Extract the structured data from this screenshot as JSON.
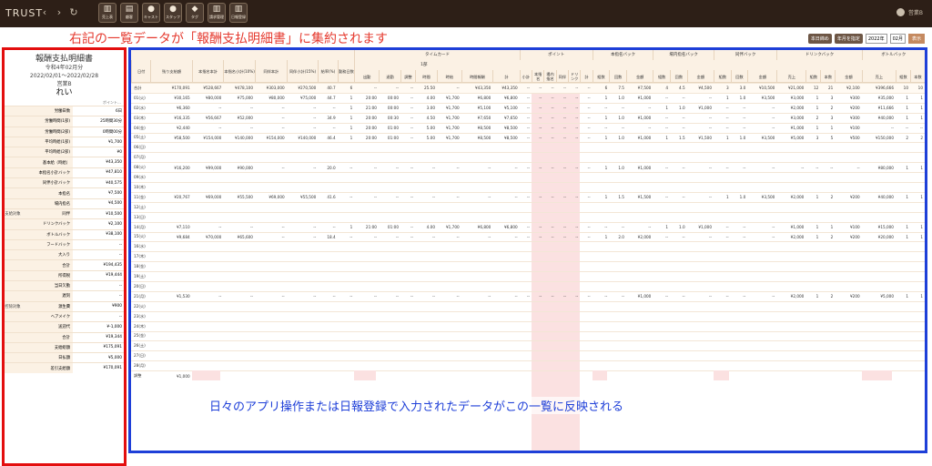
{
  "topbar": {
    "logo": "TRUST",
    "nav": [
      "‹",
      "›",
      "↻"
    ],
    "tools": [
      {
        "glyph": "▥",
        "label": "売上表"
      },
      {
        "glyph": "▤",
        "label": "顧客"
      },
      {
        "glyph": "●",
        "label": "キャスト"
      },
      {
        "glyph": "●",
        "label": "スタッフ"
      },
      {
        "glyph": "◆",
        "label": "タグ"
      },
      {
        "glyph": "▥",
        "label": "請求管理"
      },
      {
        "glyph": "▥",
        "label": "日報登録"
      }
    ],
    "user": "営業B"
  },
  "heading": "右記の一覧データが「報酬支払明細書」に集約されます",
  "controls": {
    "daily_button": "本日締め",
    "period_label": "年月を指定",
    "year": "2022年",
    "month": "02月",
    "go": "表示"
  },
  "left_panel": {
    "title": "報酬支払明細書",
    "issued": "令和4年02月分",
    "period": "2022/02/01〜2022/02/28",
    "store": "営業B",
    "name": "れい",
    "point_label": "ポイント…",
    "rows": [
      {
        "group": "",
        "label": "労働日数",
        "value": "6日"
      },
      {
        "group": "",
        "label": "労働時間(1部)",
        "value": "25時間30分"
      },
      {
        "group": "",
        "label": "労働時間(2部)",
        "value": "0時間00分"
      },
      {
        "group": "",
        "label": "平均時給(1部)",
        "value": "¥1,700"
      },
      {
        "group": "",
        "label": "平均時給(2部)",
        "value": "¥0"
      },
      {
        "group": "",
        "label": "基本給（時給）",
        "value": "¥43,350"
      },
      {
        "group": "",
        "label": "本指名小計バック",
        "value": "¥47,810"
      },
      {
        "group": "",
        "label": "同伴小計バック",
        "value": "¥40,575"
      },
      {
        "group": "",
        "label": "本指名",
        "value": "¥7,500"
      },
      {
        "group": "",
        "label": "場内指名",
        "value": "¥4,500"
      },
      {
        "group": "支給対象",
        "label": "同伴",
        "value": "¥10,500"
      },
      {
        "group": "",
        "label": "ドリンクバック",
        "value": "¥2,100"
      },
      {
        "group": "",
        "label": "ボトルバック",
        "value": "¥38,100"
      },
      {
        "group": "",
        "label": "フードバック",
        "value": "--"
      },
      {
        "group": "",
        "label": "大入り",
        "value": "--"
      },
      {
        "group": "",
        "label": "合計",
        "value": "¥194,435"
      },
      {
        "group": "",
        "label": "所得税",
        "value": "¥19,444"
      },
      {
        "group": "",
        "label": "当日欠勤",
        "value": "--"
      },
      {
        "group": "",
        "label": "遅刻",
        "value": "--"
      },
      {
        "group": "控除対象",
        "label": "源生費",
        "value": "¥900"
      },
      {
        "group": "",
        "label": "ヘアメイク",
        "value": "--"
      },
      {
        "group": "",
        "label": "送迎代",
        "value": "¥-1,000"
      },
      {
        "group": "",
        "label": "合計",
        "value": "¥19,344"
      },
      {
        "group": "",
        "label": "支給総額",
        "value": "¥175,091"
      },
      {
        "group": "",
        "label": "日払額",
        "value": "¥5,000"
      },
      {
        "group": "",
        "label": "差引支給額",
        "value": "¥170,091"
      }
    ]
  },
  "table": {
    "groups": [
      "タイムカード",
      "ポイント",
      "本指名バック",
      "場内指名バック",
      "同伴バック",
      "ドリンクバック",
      "ボトルバック"
    ],
    "subgroup": "1部",
    "columns": [
      "日付",
      "残り支給額",
      "本指名本計",
      "本指名小計(10%)",
      "同伴本計",
      "同伴小計(15%)",
      "給率(%)",
      "勤務日数",
      "出勤",
      "退勤",
      "調整",
      "時間",
      "時給",
      "時間報酬",
      "計",
      "小計",
      "本指名",
      "場内指名",
      "同伴",
      "ドリンク",
      "計",
      "組数",
      "回数",
      "金額",
      "組数",
      "回数",
      "金額",
      "組数",
      "回数",
      "金額",
      "売上",
      "組数",
      "本数",
      "金額",
      "売上",
      "組数",
      "本数"
    ],
    "rows": [
      {
        "date": "合計",
        "v": [
          "¥170,091",
          "¥528,667",
          "¥478,100",
          "¥303,000",
          "¥270,500",
          "40.7",
          "6",
          "--",
          "--",
          "--",
          "25.50",
          "--",
          "¥43,350",
          "¥43,350",
          "--",
          "--",
          "--",
          "--",
          "--",
          "--",
          "6",
          "7.5",
          "¥7,500",
          "4",
          "4.5",
          "¥4,500",
          "3",
          "3.0",
          "¥10,500",
          "¥21,000",
          "12",
          "21",
          "¥2,100",
          "¥396,666",
          "10",
          "10"
        ]
      },
      {
        "date": "01(火)",
        "v": [
          "¥30,165",
          "¥80,000",
          "¥75,000",
          "¥80,000",
          "¥75,000",
          "44.7",
          "1",
          "20:00",
          "00:00",
          "--",
          "4.00",
          "¥1,700",
          "¥6,800",
          "¥6,800",
          "--",
          "--",
          "--",
          "--",
          "--",
          "--",
          "1",
          "1.0",
          "¥1,000",
          "--",
          "--",
          "--",
          "1",
          "1.0",
          "¥3,500",
          "¥3,000",
          "1",
          "3",
          "¥300",
          "¥35,000",
          "1",
          "1"
        ]
      },
      {
        "date": "02(水)",
        "v": [
          "¥6,360",
          "--",
          "--",
          "--",
          "--",
          "--",
          "1",
          "21:00",
          "00:00",
          "--",
          "3.00",
          "¥1,700",
          "¥5,100",
          "¥5,100",
          "--",
          "--",
          "--",
          "--",
          "--",
          "--",
          "--",
          "--",
          "--",
          "1",
          "1.0",
          "¥1,000",
          "--",
          "--",
          "--",
          "¥2,000",
          "1",
          "2",
          "¥200",
          "¥11,666",
          "1",
          "1"
        ]
      },
      {
        "date": "03(木)",
        "v": [
          "¥16,335",
          "¥56,667",
          "¥52,000",
          "--",
          "--",
          "34.9",
          "1",
          "20:00",
          "00:30",
          "--",
          "4.50",
          "¥1,700",
          "¥7,650",
          "¥7,650",
          "--",
          "--",
          "--",
          "--",
          "--",
          "--",
          "1",
          "1.0",
          "¥1,000",
          "--",
          "--",
          "--",
          "--",
          "--",
          "--",
          "¥3,000",
          "2",
          "3",
          "¥300",
          "¥40,000",
          "1",
          "1"
        ]
      },
      {
        "date": "04(金)",
        "v": [
          "¥2,440",
          "--",
          "--",
          "--",
          "--",
          "--",
          "1",
          "20:00",
          "01:00",
          "--",
          "5.00",
          "¥1,700",
          "¥8,500",
          "¥8,500",
          "--",
          "--",
          "--",
          "--",
          "--",
          "--",
          "--",
          "--",
          "--",
          "--",
          "--",
          "--",
          "--",
          "--",
          "--",
          "¥1,000",
          "1",
          "1",
          "¥100",
          "--",
          "--",
          "--"
        ]
      },
      {
        "date": "05(土)",
        "v": [
          "¥58,500",
          "¥154,000",
          "¥140,000",
          "¥154,000",
          "¥140,000",
          "46.4",
          "1",
          "20:00",
          "01:00",
          "--",
          "5.00",
          "¥1,700",
          "¥8,500",
          "¥8,500",
          "--",
          "--",
          "--",
          "--",
          "--",
          "--",
          "1",
          "1.0",
          "¥1,000",
          "1",
          "1.5",
          "¥1,500",
          "1",
          "1.0",
          "¥3,500",
          "¥5,000",
          "3",
          "5",
          "¥500",
          "¥150,000",
          "2",
          "2"
        ]
      },
      {
        "date": "06(日)",
        "v": []
      },
      {
        "date": "07(月)",
        "v": []
      },
      {
        "date": "08(火)",
        "v": [
          "¥16,200",
          "¥99,000",
          "¥90,000",
          "--",
          "--",
          "20.0",
          "--",
          "--",
          "--",
          "--",
          "--",
          "--",
          "--",
          "--",
          "--",
          "--",
          "--",
          "--",
          "--",
          "--",
          "1",
          "1.0",
          "¥1,000",
          "--",
          "--",
          "--",
          "--",
          "--",
          "--",
          "--",
          "--",
          "--",
          "--",
          "¥80,000",
          "1",
          "1"
        ]
      },
      {
        "date": "09(水)",
        "v": []
      },
      {
        "date": "10(木)",
        "v": []
      },
      {
        "date": "11(金)",
        "v": [
          "¥20,767",
          "¥69,000",
          "¥55,500",
          "¥69,000",
          "¥55,500",
          "41.6",
          "--",
          "--",
          "--",
          "--",
          "--",
          "--",
          "--",
          "--",
          "--",
          "--",
          "--",
          "--",
          "--",
          "--",
          "1",
          "1.5",
          "¥1,500",
          "--",
          "--",
          "--",
          "1",
          "1.0",
          "¥3,500",
          "¥2,000",
          "1",
          "2",
          "¥200",
          "¥40,000",
          "1",
          "1"
        ]
      },
      {
        "date": "12(土)",
        "v": []
      },
      {
        "date": "13(日)",
        "v": []
      },
      {
        "date": "14(月)",
        "v": [
          "¥7,110",
          "--",
          "--",
          "--",
          "--",
          "--",
          "1",
          "21:00",
          "01:00",
          "--",
          "4.00",
          "¥1,700",
          "¥6,800",
          "¥6,800",
          "--",
          "--",
          "--",
          "--",
          "--",
          "--",
          "--",
          "--",
          "--",
          "1",
          "1.0",
          "¥1,000",
          "--",
          "--",
          "--",
          "¥1,000",
          "1",
          "1",
          "¥100",
          "¥15,000",
          "1",
          "1"
        ]
      },
      {
        "date": "15(火)",
        "v": [
          "¥9,684",
          "¥70,000",
          "¥65,600",
          "--",
          "--",
          "18.4",
          "--",
          "--",
          "--",
          "--",
          "--",
          "--",
          "--",
          "--",
          "--",
          "--",
          "--",
          "--",
          "--",
          "--",
          "1",
          "2.0",
          "¥2,000",
          "--",
          "--",
          "--",
          "--",
          "--",
          "--",
          "¥2,000",
          "1",
          "2",
          "¥200",
          "¥20,000",
          "1",
          "1"
        ]
      },
      {
        "date": "16(水)",
        "v": []
      },
      {
        "date": "17(木)",
        "v": []
      },
      {
        "date": "18(金)",
        "v": []
      },
      {
        "date": "19(土)",
        "v": []
      },
      {
        "date": "20(日)",
        "v": []
      },
      {
        "date": "21(月)",
        "v": [
          "¥1,530",
          "--",
          "--",
          "--",
          "--",
          "--",
          "--",
          "--",
          "--",
          "--",
          "--",
          "--",
          "--",
          "--",
          "--",
          "--",
          "--",
          "--",
          "--",
          "--",
          "--",
          "--",
          "¥1,000",
          "--",
          "--",
          "--",
          "--",
          "--",
          "--",
          "¥2,000",
          "1",
          "2",
          "¥200",
          "¥5,000",
          "1",
          "1"
        ]
      },
      {
        "date": "22(火)",
        "v": []
      },
      {
        "date": "23(水)",
        "v": []
      },
      {
        "date": "24(木)",
        "v": []
      },
      {
        "date": "25(金)",
        "v": []
      },
      {
        "date": "26(土)",
        "v": []
      },
      {
        "date": "27(日)",
        "v": []
      },
      {
        "date": "28(月)",
        "v": []
      },
      {
        "date": "調整",
        "v": [
          "¥1,000"
        ]
      }
    ]
  },
  "overlay": "日々のアプリ操作または日報登録で入力されたデータがこの一覧に反映される"
}
